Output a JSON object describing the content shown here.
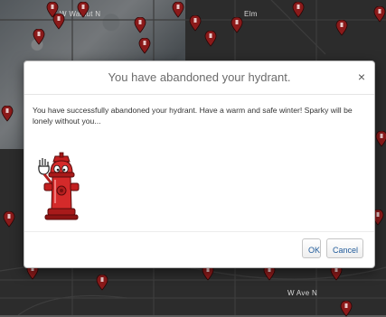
{
  "map": {
    "streets": [
      "W Walnut N",
      "Elm",
      "W Ave N"
    ]
  },
  "dialog": {
    "title": "You have abandoned your hydrant.",
    "close_label": "×",
    "message": "You have successfully abandoned your hydrant. Have a warm and safe winter! Sparky will be lonely without you...",
    "ok_label": "OK",
    "cancel_label": "Cancel"
  },
  "colors": {
    "marker": "#8b1a1a",
    "hydrant": "#d42a2a",
    "link": "#1f5a9a"
  }
}
